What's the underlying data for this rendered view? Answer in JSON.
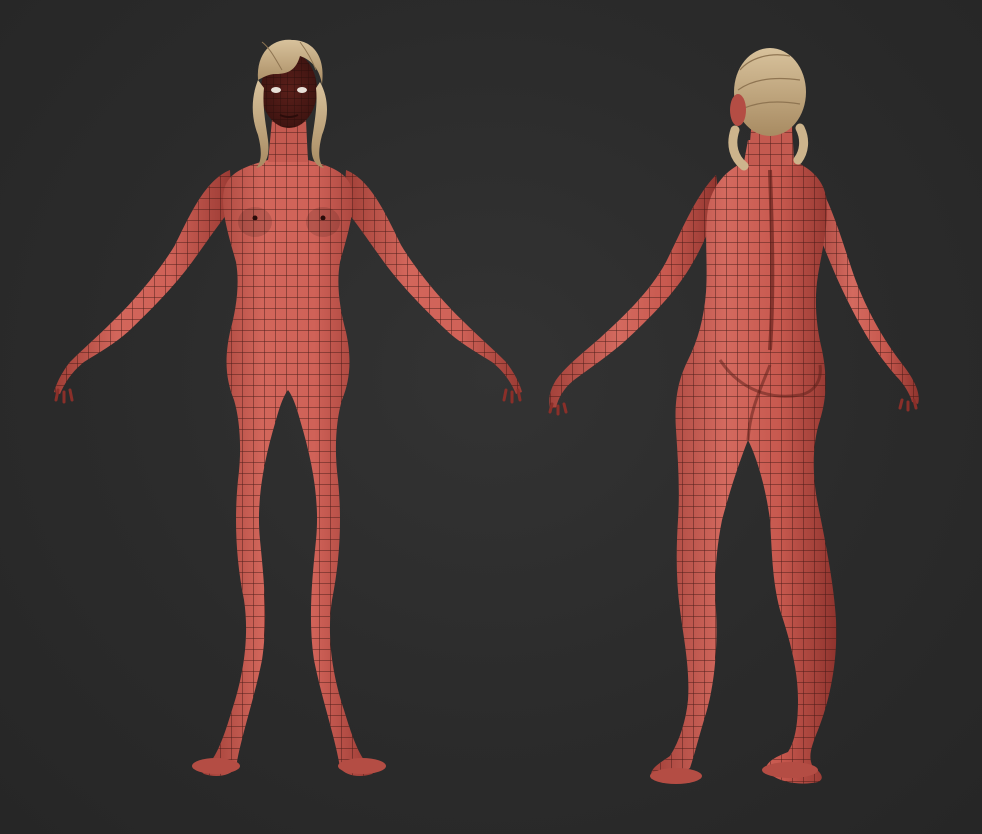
{
  "scene": {
    "background_color": "#2b2b2b",
    "skin_color": "#c9564c",
    "skin_dark_color": "#7a2a24",
    "wire_color": "#3a1410",
    "hair_color": "#cdb48c",
    "hair_dark_color": "#8f7552"
  },
  "views": [
    {
      "view": "front"
    },
    {
      "view": "back"
    }
  ]
}
